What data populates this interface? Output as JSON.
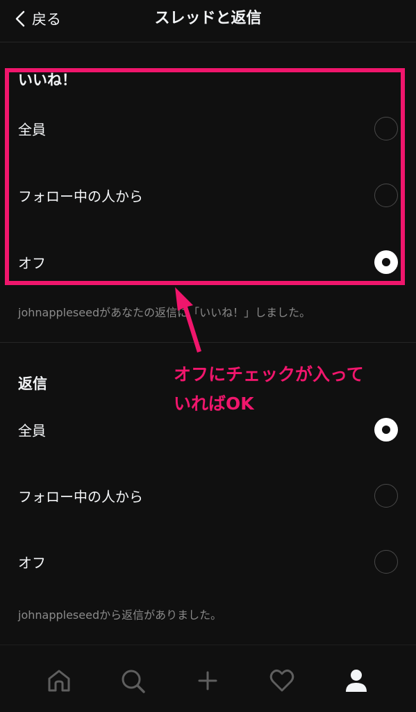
{
  "header": {
    "back_label": "戻る",
    "title": "スレッドと返信"
  },
  "likes": {
    "title": "いいね！",
    "options": [
      {
        "label": "全員",
        "selected": false
      },
      {
        "label": "フォロー中の人から",
        "selected": false
      },
      {
        "label": "オフ",
        "selected": true
      }
    ],
    "caption": "johnappleseedがあなたの返信に「いいね！」しました。"
  },
  "replies": {
    "title": "返信",
    "options": [
      {
        "label": "全員",
        "selected": true
      },
      {
        "label": "フォロー中の人から",
        "selected": false
      },
      {
        "label": "オフ",
        "selected": false
      }
    ],
    "caption": "johnappleseedから返信がありました。"
  },
  "annotation": {
    "line1": "オフにチェックが入って",
    "line2": "いればOK",
    "color": "#f0166c"
  },
  "nav": {
    "items": [
      "home-icon",
      "search-icon",
      "plus-icon",
      "heart-icon",
      "profile-icon"
    ]
  }
}
